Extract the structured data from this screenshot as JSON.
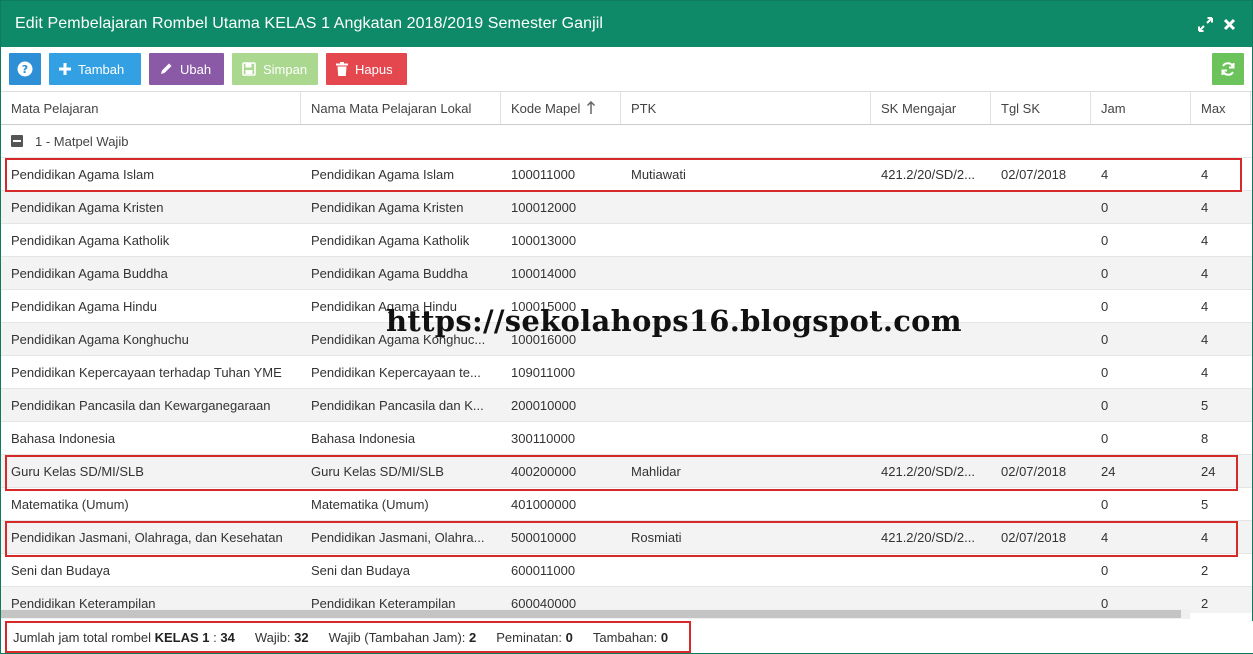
{
  "window": {
    "title": "Edit Pembelajaran Rombel Utama KELAS 1 Angkatan 2018/2019 Semester Ganjil"
  },
  "toolbar": {
    "tambah_label": "Tambah",
    "ubah_label": "Ubah",
    "simpan_label": "Simpan",
    "hapus_label": "Hapus"
  },
  "columns": [
    "Mata Pelajaran",
    "Nama Mata Pelajaran Lokal",
    "Kode Mapel",
    "PTK",
    "SK Mengajar",
    "Tgl SK",
    "Jam",
    "Max"
  ],
  "group": {
    "label": "1 - Matpel Wajib"
  },
  "rows": [
    {
      "mapel": "Pendidikan Agama Islam",
      "lokal": "Pendidikan Agama Islam",
      "kode": "100011000",
      "ptk": "Mutiawati",
      "sk": "421.2/20/SD/2...",
      "tgl": "02/07/2018",
      "jam": "4",
      "max": "4"
    },
    {
      "mapel": "Pendidikan Agama Kristen",
      "lokal": "Pendidikan Agama Kristen",
      "kode": "100012000",
      "ptk": "",
      "sk": "",
      "tgl": "",
      "jam": "0",
      "max": "4"
    },
    {
      "mapel": "Pendidikan Agama Katholik",
      "lokal": "Pendidikan Agama Katholik",
      "kode": "100013000",
      "ptk": "",
      "sk": "",
      "tgl": "",
      "jam": "0",
      "max": "4"
    },
    {
      "mapel": "Pendidikan Agama Buddha",
      "lokal": "Pendidikan Agama Buddha",
      "kode": "100014000",
      "ptk": "",
      "sk": "",
      "tgl": "",
      "jam": "0",
      "max": "4"
    },
    {
      "mapel": "Pendidikan Agama Hindu",
      "lokal": "Pendidikan Agama Hindu",
      "kode": "100015000",
      "ptk": "",
      "sk": "",
      "tgl": "",
      "jam": "0",
      "max": "4"
    },
    {
      "mapel": "Pendidikan Agama Konghuchu",
      "lokal": "Pendidikan Agama Konghuc...",
      "kode": "100016000",
      "ptk": "",
      "sk": "",
      "tgl": "",
      "jam": "0",
      "max": "4"
    },
    {
      "mapel": "Pendidikan Kepercayaan terhadap Tuhan YME",
      "lokal": "Pendidikan Kepercayaan te...",
      "kode": "109011000",
      "ptk": "",
      "sk": "",
      "tgl": "",
      "jam": "0",
      "max": "4"
    },
    {
      "mapel": "Pendidikan Pancasila dan Kewarganegaraan",
      "lokal": "Pendidikan Pancasila dan K...",
      "kode": "200010000",
      "ptk": "",
      "sk": "",
      "tgl": "",
      "jam": "0",
      "max": "5"
    },
    {
      "mapel": "Bahasa Indonesia",
      "lokal": "Bahasa Indonesia",
      "kode": "300110000",
      "ptk": "",
      "sk": "",
      "tgl": "",
      "jam": "0",
      "max": "8"
    },
    {
      "mapel": "Guru Kelas SD/MI/SLB",
      "lokal": "Guru Kelas SD/MI/SLB",
      "kode": "400200000",
      "ptk": "Mahlidar",
      "sk": "421.2/20/SD/2...",
      "tgl": "02/07/2018",
      "jam": "24",
      "max": "24"
    },
    {
      "mapel": "Matematika (Umum)",
      "lokal": "Matematika (Umum)",
      "kode": "401000000",
      "ptk": "",
      "sk": "",
      "tgl": "",
      "jam": "0",
      "max": "5"
    },
    {
      "mapel": "Pendidikan Jasmani, Olahraga, dan Kesehatan",
      "lokal": "Pendidikan Jasmani, Olahra...",
      "kode": "500010000",
      "ptk": "Rosmiati",
      "sk": "421.2/20/SD/2...",
      "tgl": "02/07/2018",
      "jam": "4",
      "max": "4"
    },
    {
      "mapel": "Seni dan Budaya",
      "lokal": "Seni dan Budaya",
      "kode": "600011000",
      "ptk": "",
      "sk": "",
      "tgl": "",
      "jam": "0",
      "max": "2"
    },
    {
      "mapel": "Pendidikan Keterampilan",
      "lokal": "Pendidikan Keterampilan",
      "kode": "600040000",
      "ptk": "",
      "sk": "",
      "tgl": "",
      "jam": "0",
      "max": "2"
    }
  ],
  "watermark": "https://sekolahops16.blogspot.com",
  "footer": {
    "total_label": "Jumlah jam total rombel",
    "kelas": "KELAS 1",
    "total_sep": ":",
    "total_value": "34",
    "wajib_label": "Wajib:",
    "wajib_value": "32",
    "wajib_tambahan_label": "Wajib (Tambahan Jam):",
    "wajib_tambahan_value": "2",
    "peminatan_label": "Peminatan:",
    "peminatan_value": "0",
    "tambahan_label": "Tambahan:",
    "tambahan_value": "0"
  },
  "colors": {
    "titlebar": "#0f8a68",
    "highlight": "#d62a2a",
    "tambah": "#33a0e3",
    "ubah": "#8b5aa6",
    "simpan": "#a9d88e",
    "hapus": "#e5474f",
    "refresh": "#6dc35b"
  }
}
